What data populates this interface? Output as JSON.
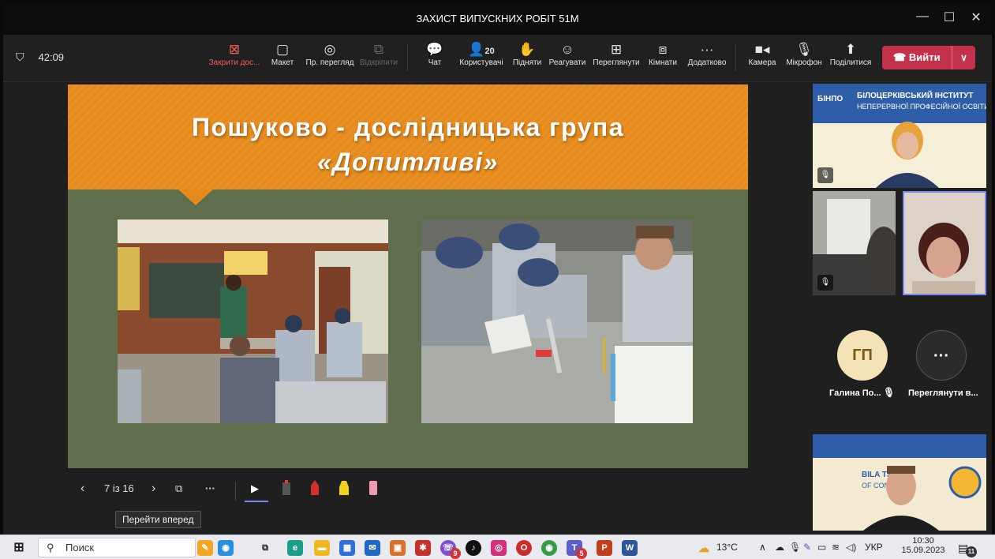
{
  "window": {
    "title": "ЗАХИСТ ВИПУСКНИХ РОБІТ 51М"
  },
  "toolbar": {
    "timer": "42:09",
    "stop_share": "Закрити дос...",
    "layout": "Макет",
    "view": "Пр. перегляд",
    "unpin": "Відкріпити",
    "chat": "Чат",
    "people_count": "20",
    "people": "Користувачі",
    "raise": "Підняти",
    "react": "Реагувати",
    "view_all": "Переглянути",
    "rooms": "Кімнати",
    "more_icon": "···",
    "more": "Додатково",
    "camera": "Камера",
    "mic": "Мікрофон",
    "share": "Поділитися",
    "leave": "Вийти"
  },
  "slide": {
    "title_line1": "Пошуково - дослідницька  група",
    "title_line2": "«Допитливі»",
    "page_indicator": "7 із 16",
    "more_icon": "···",
    "tooltip": "Перейти вперед"
  },
  "participants": {
    "tile1_banner_line1": "БІЛОЦЕРКІВСЬКИЙ ІНСТИТУТ",
    "tile1_banner_line2": "НЕПЕРЕРВНОЇ ПРОФЕСІЙНОЇ ОСВІТИ",
    "tile1_logo": "БІНПО",
    "avatar_initials": "ГП",
    "avatar_name": "Галина По...",
    "view_more_icon": "···",
    "view_more": "Переглянути в...",
    "tile4_text1": "BILA TS",
    "tile4_text2": "OF CONT"
  },
  "taskbar": {
    "search": "Поиск",
    "temperature": "13°C",
    "language": "УКР",
    "time": "10:30",
    "date": "15.09.2023",
    "badge_teams": "5",
    "badge_viber": "9",
    "notif_count": "11"
  },
  "colors": {
    "banner": "#e68a1c",
    "slide_bg": "#5f6e4d",
    "leave_btn": "#c4314b",
    "stop_share": "#f25c5c",
    "avatar_bg": "#f3e3b6"
  }
}
